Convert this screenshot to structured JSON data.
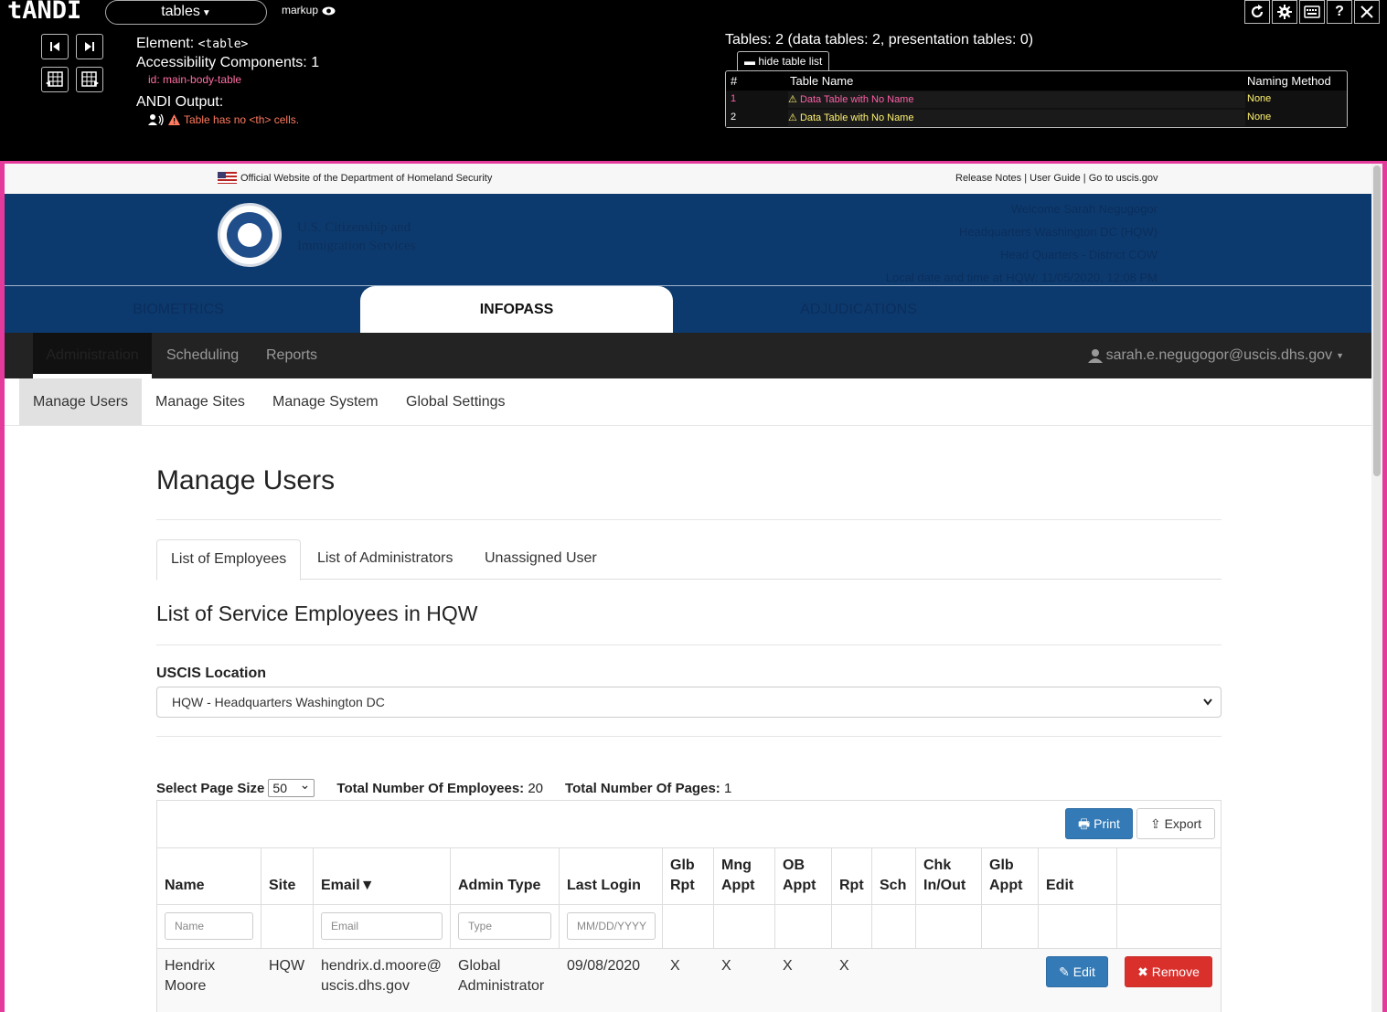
{
  "andi": {
    "logo": "tANDI",
    "module": "tables",
    "markup": "markup",
    "element_label": "Element:",
    "element_value": "<table>",
    "components": "Accessibility Components: 1",
    "id_label": "id:",
    "id_value": "main-body-table",
    "output_label": "ANDI Output:",
    "alert": "Table has no <th> cells.",
    "tables_summary": "Tables: 2 (data tables: 2, presentation tables: 0)",
    "hide_list": "hide table list",
    "list_headers": {
      "num": "#",
      "name": "Table Name",
      "method": "Naming Method"
    },
    "list_rows": [
      {
        "num": "1",
        "name": "Data Table with No Name",
        "method": "None"
      },
      {
        "num": "2",
        "name": "Data Table with No Name",
        "method": "None"
      }
    ],
    "right_buttons": [
      "refresh-icon",
      "gear-icon",
      "keyboard-icon",
      "help-icon",
      "close-icon"
    ],
    "help": "?"
  },
  "site": {
    "gov_banner": "Official Website of the Department of Homeland Security",
    "gov_links": "Release Notes | User Guide | Go to uscis.gov",
    "agency_line1": "U.S. Citizenship and",
    "agency_line2": "Immigration Services",
    "welcome": "Welcome Sarah Negugogor",
    "hq": "Headquarters Washington DC (HQW)",
    "district": "Head Quarters - District COW",
    "datetime": "Local date and time at HQW: 11/05/2020, 12:08 PM",
    "app_tabs": [
      "BIOMETRICS",
      "INFOPASS",
      "ADJUDICATIONS"
    ],
    "top_nav": [
      "Administration",
      "Scheduling",
      "Reports"
    ],
    "user": "sarah.e.negugogor@uscis.dhs.gov",
    "sub_nav": [
      "Manage Users",
      "Manage Sites",
      "Manage System",
      "Global Settings"
    ]
  },
  "main": {
    "title": "Manage Users",
    "tabs": [
      "List of Employees",
      "List of Administrators",
      "Unassigned User"
    ],
    "subtitle": "List of Service Employees in HQW",
    "location_label": "USCIS Location",
    "location_value": "HQW - Headquarters Washington DC",
    "page_size_label": "Select Page Size",
    "page_size_value": "50",
    "total_emp_label": "Total Number Of Employees:",
    "total_emp_value": "20",
    "total_pages_label": "Total Number Of Pages:",
    "total_pages_value": "1",
    "print": "Print",
    "export": "Export",
    "columns": [
      "Name",
      "Site",
      "Email▼",
      "Admin Type",
      "Last Login",
      "Glb Rpt",
      "Mng Appt",
      "OB Appt",
      "Rpt",
      "Sch",
      "Chk In/Out",
      "Glb Appt",
      "Edit"
    ],
    "filters": {
      "name": "Name",
      "email": "Email",
      "type": "Type",
      "date": "MM/DD/YYYY"
    },
    "row": {
      "name": "Hendrix Moore",
      "site": "HQW",
      "email": "hendrix.d.moore@uscis.dhs.gov",
      "admin_type": "Global Administrator",
      "last_login": "09/08/2020",
      "glb_rpt": "X",
      "mng_appt": "X",
      "ob_appt": "X",
      "rpt": "X",
      "edit": "Edit",
      "remove": "Remove"
    }
  }
}
